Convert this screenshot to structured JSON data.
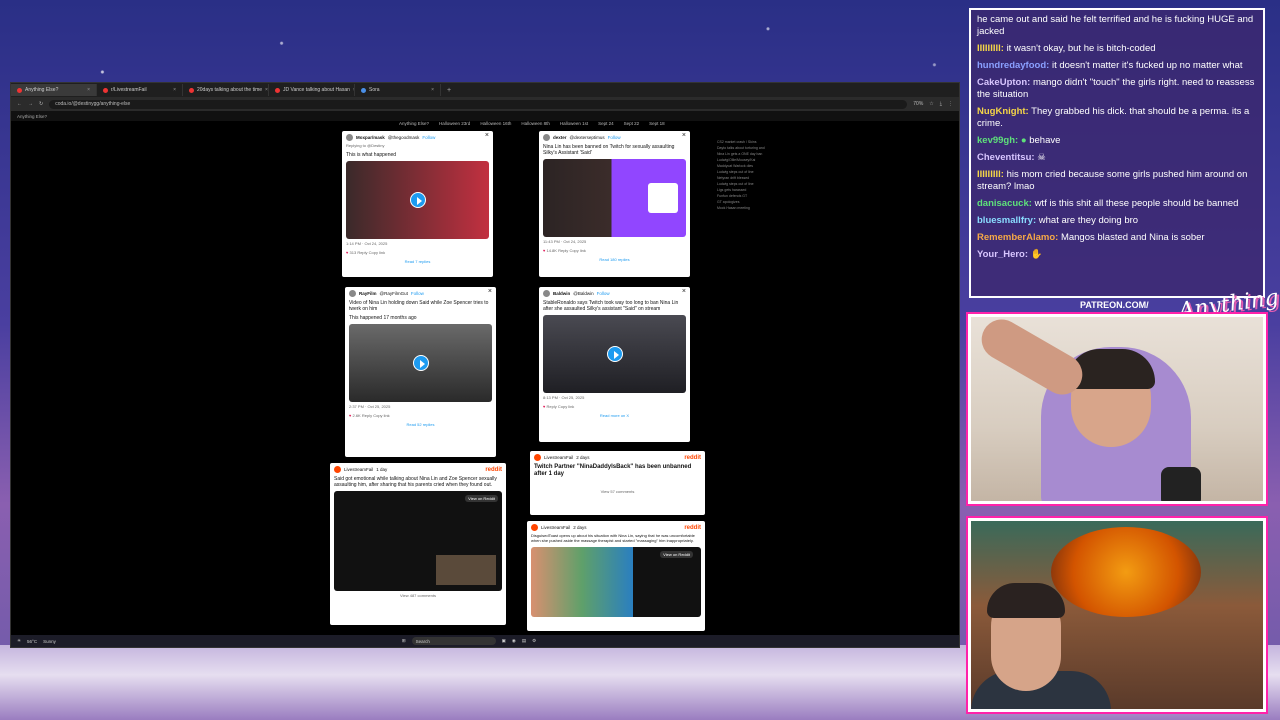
{
  "browser": {
    "tabs": [
      {
        "label": "Anything Else?",
        "active": true
      },
      {
        "label": "r/LivestreamFail",
        "active": false
      },
      {
        "label": "20days talking about the time",
        "active": false
      },
      {
        "label": "JD Vance talking about Hasan",
        "active": false
      },
      {
        "label": "Sora",
        "active": false
      }
    ],
    "url": "coda.io/@destinygg/anything-else",
    "zoom": "70%",
    "bookmark": "Anything Else?",
    "nav_links": [
      "Anything Else?",
      "Halloween 23rd",
      "Halloween 16th",
      "Halloween 8th",
      "Halloween 1st",
      "Sept 24",
      "Sept 22",
      "Sept 18"
    ]
  },
  "cards": {
    "c1": {
      "author": "Moxpar/mask",
      "handle": "@thegoodmask",
      "follow": "Follow",
      "reply_to": "Replying to @Destiny",
      "text": "This is what happened",
      "watch": "Watch on X",
      "date": "1:14 PM · Oct 24, 2025",
      "likes": "313",
      "reply": "Reply",
      "copy": "Copy link",
      "read": "Read 7 replies"
    },
    "c2": {
      "author": "dexter",
      "handle": "@dexterseptimus",
      "follow": "Follow",
      "text": "Nina Lin has been banned on Twitch for sexually assaulting Silky's Assistant 'Said'",
      "date": "11:43 PM · Oct 24, 2025",
      "likes": "14.8K",
      "reply": "Reply",
      "copy": "Copy link",
      "read": "Read 180 replies"
    },
    "c3": {
      "author": "RayFilm",
      "handle": "@RayFilmGut",
      "follow": "Follow",
      "text": "Video of Nina Lin holding down Said while Zoe Spencer tries to twerk on him",
      "sub": "This happened 17 months ago",
      "watch": "Watch on X",
      "date": "2:37 PM · Oct 25, 2025",
      "likes": "2.6K",
      "reply": "Reply",
      "copy": "Copy link",
      "read": "Read 52 replies"
    },
    "c4": {
      "author": "Baldwin",
      "handle": "@Baldwin",
      "follow": "Follow",
      "text": "StableRonaldo says Twitch took way too long to ban Nina Lin after she assaulted Silky's assistant \"Said\" on stream",
      "date": "8:13 PM · Oct 25, 2025",
      "likes": "",
      "reply": "Reply",
      "copy": "Copy link",
      "read": "Read more on X"
    },
    "c5": {
      "sub": "LivestreamFail",
      "time": "1 day",
      "text": "Said got emotional while talking about Nina Lin and Zoe Spencer sexually assaulting him, after sharing that his parents cried when they found out.",
      "reddit": "reddit",
      "view": "View on Reddit",
      "comments": "View 487 comments"
    },
    "c6": {
      "sub": "LivestreamFail",
      "time": "2 days",
      "title": "Twitch Partner \"NinaDaddyIsBack\" has been unbanned after 1 day",
      "reddit": "reddit",
      "comments": "View 57 comments"
    },
    "c7": {
      "sub": "LivestreamFail",
      "time": "2 days",
      "text": "DisguisedToast opens up about his situation with Nina Lin, saying that he was uncomfortable when she pushed aside the massage therapist and started \"massaging\" him inappropriately.",
      "reddit": "reddit",
      "view": "View on Reddit"
    }
  },
  "sidelist": [
    "CS2 market crash / Skins",
    "Dayto talks about torturing and",
    "Nina Lin gets a ONE day ban",
    "Ludwig/Ollie/Mousey/Kai",
    "Maddycat Warlock dies",
    "Ludwig steps out of line",
    "Netyran drift blessed",
    "Ludwig steps out of line",
    "Ligs gets harassed",
    "Funfun defends GT",
    "GT apologizes",
    "Mock Hasan meeting"
  ],
  "taskbar": {
    "weather_temp": "56°C",
    "weather_desc": "Sunny",
    "search": "Search"
  },
  "chat": [
    {
      "user": "",
      "text": "he came out and said he felt terrified and he is fucking HUGE and jacked",
      "color": "#ffffff"
    },
    {
      "user": "IIIIIIIIl:",
      "text": "it wasn't okay, but he is bitch-coded",
      "color": "#f5d547"
    },
    {
      "user": "hundredayfood:",
      "text": "it doesn't matter it's fucked up no matter what",
      "color": "#8aa0ff"
    },
    {
      "user": "CakeUpton:",
      "text": "mango didn't \"touch\" the girls right. need to reassess the situation",
      "color": "#d8c6ff"
    },
    {
      "user": "NugKnight:",
      "text": "They grabbed his dick. that should be a perma. its a crime.",
      "color": "#f5d547"
    },
    {
      "user": "kev99gh:",
      "text": "behave",
      "color": "#5ee07a"
    },
    {
      "user": "Cheventitsu:",
      "text": "",
      "color": "#d8c6ff"
    },
    {
      "user": "IIIIIIIIl:",
      "text": "his mom cried because some girls pushed him around on stream? lmao",
      "color": "#f5d547"
    },
    {
      "user": "danisacuck:",
      "text": "wtf is this shit all these people should be banned",
      "color": "#5ee07a"
    },
    {
      "user": "bluesmallfry:",
      "text": "what are they doing bro",
      "color": "#8adcff"
    },
    {
      "user": "RememberAlamo:",
      "text": "Mangos blasted and Nina is sober",
      "color": "#f5a847"
    },
    {
      "user": "Your_Hero:",
      "text": "",
      "color": "#d8c6ff"
    }
  ],
  "overlay": {
    "patreon": "PATREON.COM/",
    "logo": "Anything Else?"
  }
}
